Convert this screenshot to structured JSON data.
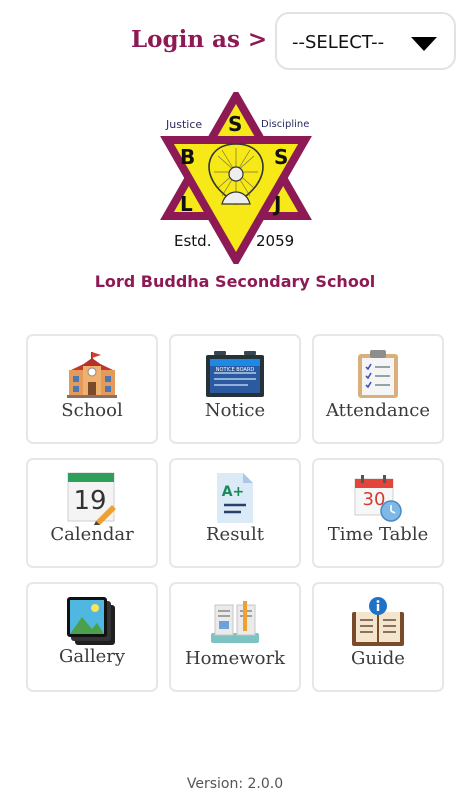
{
  "header": {
    "login_label": "Login as >",
    "select_value": "--SELECT--"
  },
  "logo": {
    "motto_left": "Justice",
    "motto_right": "Discipline",
    "letters": [
      "S",
      "B",
      "S",
      "L",
      "J"
    ],
    "estd_label": "Estd.",
    "estd_year": "2059",
    "colors": {
      "frame": "#8e1a55",
      "fill": "#f7e818"
    }
  },
  "school_name": "Lord Buddha Secondary School",
  "menu": [
    {
      "label": "School",
      "icon": "school-building-icon"
    },
    {
      "label": "Notice",
      "icon": "notice-board-icon",
      "icon_text": "NOTICE BOARD"
    },
    {
      "label": "Attendance",
      "icon": "clipboard-checklist-icon"
    },
    {
      "label": "Calendar",
      "icon": "calendar-icon",
      "icon_text": "19"
    },
    {
      "label": "Result",
      "icon": "result-sheet-icon",
      "icon_text": "A+"
    },
    {
      "label": "Time Table",
      "icon": "timetable-icon",
      "icon_text": "30"
    },
    {
      "label": "Gallery",
      "icon": "gallery-icon"
    },
    {
      "label": "Homework",
      "icon": "homework-icon"
    },
    {
      "label": "Guide",
      "icon": "guide-book-icon"
    }
  ],
  "version": "Version: 2.0.0"
}
